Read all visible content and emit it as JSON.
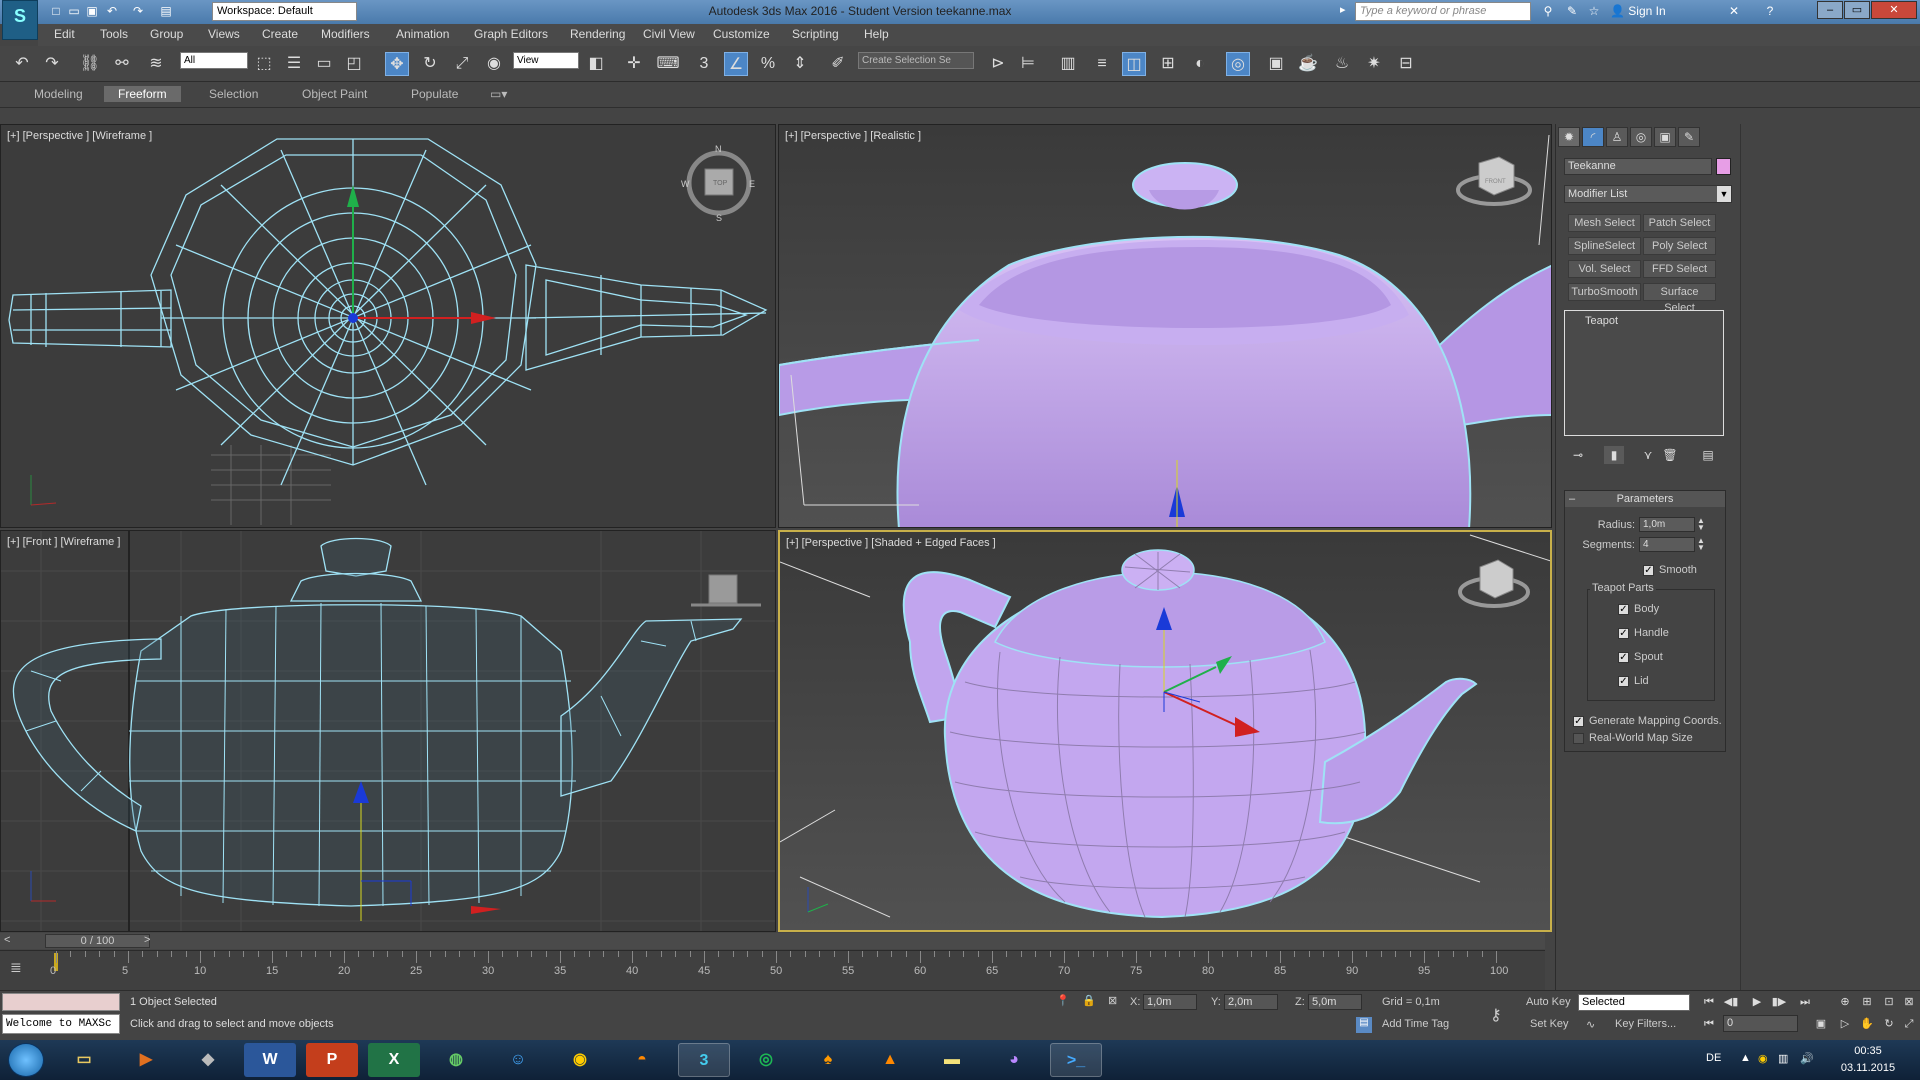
{
  "titlebar": {
    "workspace": "Workspace: Default",
    "title": "Autodesk 3ds Max 2016 - Student Version    teekanne.max",
    "search_placeholder": "Type a keyword or phrase",
    "signin": "Sign In"
  },
  "menu": [
    "Edit",
    "Tools",
    "Group",
    "Views",
    "Create",
    "Modifiers",
    "Animation",
    "Graph Editors",
    "Rendering",
    "Civil View",
    "Customize",
    "Scripting",
    "Help"
  ],
  "toolbar": {
    "filter": "All",
    "refcoord": "View",
    "selset": "Create Selection Se"
  },
  "ribbon": {
    "tabs": [
      "Modeling",
      "Freeform",
      "Selection",
      "Object Paint",
      "Populate"
    ],
    "active": "Freeform"
  },
  "viewports": {
    "top_left": "[+] [Perspective ] [Wireframe ]",
    "top_right": "[+] [Perspective ] [Realistic ]",
    "bottom_left": "[+] [Front ] [Wireframe ]",
    "bottom_right": "[+] [Perspective ] [Shaded + Edged Faces ]",
    "viewcube_top": "TOP",
    "viewcube_front": "FRONT",
    "compass": {
      "n": "N",
      "s": "S",
      "e": "E",
      "w": "W"
    }
  },
  "command_panel": {
    "object_name": "Teekanne",
    "object_color": "#e79ee6",
    "modifier_list": "Modifier List",
    "modifier_buttons": [
      "Mesh Select",
      "Patch Select",
      "SplineSelect",
      "Poly Select",
      "Vol. Select",
      "FFD Select",
      "TurboSmooth",
      "Surface Select"
    ],
    "stack_item": "Teapot",
    "parameters_title": "Parameters",
    "radius_label": "Radius:",
    "radius_value": "1,0m",
    "segments_label": "Segments:",
    "segments_value": "4",
    "smooth_label": "Smooth",
    "parts_title": "Teapot Parts",
    "parts": [
      "Body",
      "Handle",
      "Spout",
      "Lid"
    ],
    "gen_mapping": "Generate Mapping Coords.",
    "realworld": "Real-World Map Size"
  },
  "timeline": {
    "slider": "0 / 100",
    "ticks": [
      "0",
      "5",
      "10",
      "15",
      "20",
      "25",
      "30",
      "35",
      "40",
      "45",
      "50",
      "55",
      "60",
      "65",
      "70",
      "75",
      "80",
      "85",
      "90",
      "95",
      "100"
    ]
  },
  "status": {
    "maxscript": "Welcome to MAXSc",
    "selection": "1 Object Selected",
    "prompt": "Click and drag to select and move objects",
    "x_label": "X:",
    "x_value": "1,0m",
    "y_label": "Y:",
    "y_value": "2,0m",
    "z_label": "Z:",
    "z_value": "5,0m",
    "grid": "Grid = 0,1m",
    "add_time_tag": "Add Time Tag",
    "auto_key": "Auto Key",
    "set_key": "Set Key",
    "selected": "Selected",
    "key_filters": "Key Filters...",
    "frame": "0"
  },
  "taskbar": {
    "lang": "DE",
    "time": "00:35",
    "date": "03.11.2015"
  },
  "colors": {
    "teapot": "#c3a3ee",
    "wire": "#9fe2f5",
    "accent": "#4c86c6"
  }
}
